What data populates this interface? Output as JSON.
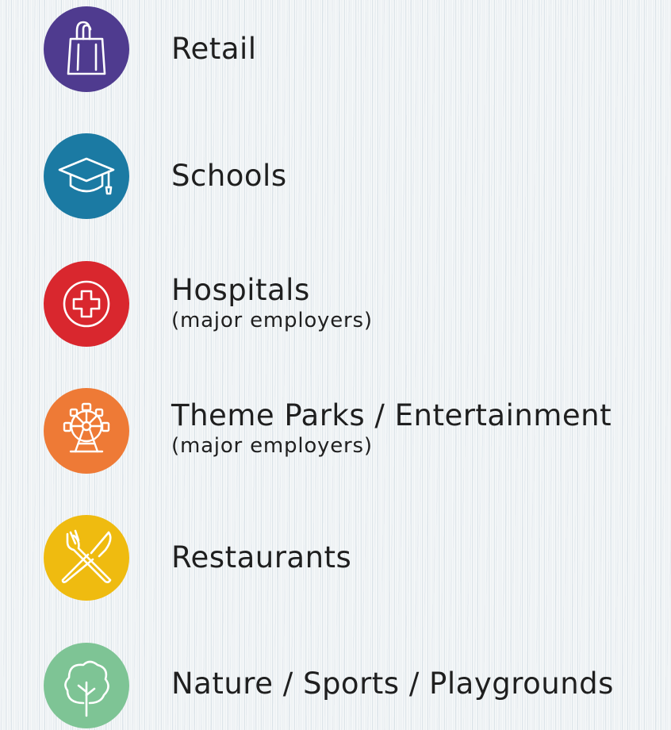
{
  "categories": [
    {
      "label": "Retail",
      "sublabel": "",
      "icon": "shopping-bag-icon",
      "color": "#4f3b8f"
    },
    {
      "label": "Schools",
      "sublabel": "",
      "icon": "graduation-cap-icon",
      "color": "#1b7aa3"
    },
    {
      "label": "Hospitals",
      "sublabel": "(major employers)",
      "icon": "medical-cross-icon",
      "color": "#d9272e"
    },
    {
      "label": "Theme Parks / Entertainment",
      "sublabel": "(major employers)",
      "icon": "ferris-wheel-icon",
      "color": "#ee7a36"
    },
    {
      "label": "Restaurants",
      "sublabel": "",
      "icon": "fork-knife-icon",
      "color": "#efbb10"
    },
    {
      "label": "Nature / Sports / Playgrounds",
      "sublabel": "",
      "icon": "tree-icon",
      "color": "#7ec495"
    }
  ]
}
